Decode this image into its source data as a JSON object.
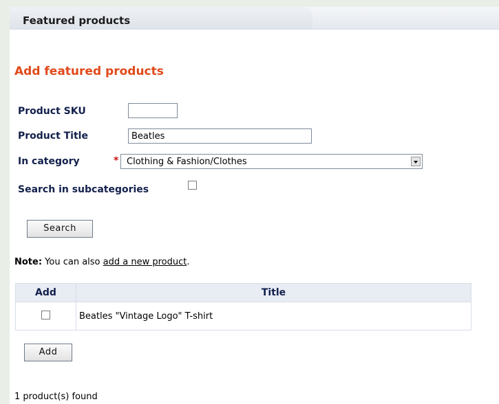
{
  "header": {
    "tab_title": "Featured products"
  },
  "section_title": "Add featured products",
  "form": {
    "sku_label": "Product SKU",
    "sku_value": "",
    "title_label": "Product Title",
    "title_value": "Beatles",
    "category_label": "In category",
    "required_mark": "*",
    "category_value": "Clothing & Fashion/Clothes",
    "subcategories_label": "Search in subcategories",
    "search_button": "Search"
  },
  "note": {
    "prefix": "Note:",
    "text": " You can also ",
    "link": "add a new product",
    "suffix": "."
  },
  "table": {
    "columns": [
      "Add",
      "Title"
    ],
    "rows": [
      {
        "title": "Beatles \"Vintage Logo\" T-shirt"
      }
    ]
  },
  "add_button": "Add",
  "status": "1 product(s) found"
}
